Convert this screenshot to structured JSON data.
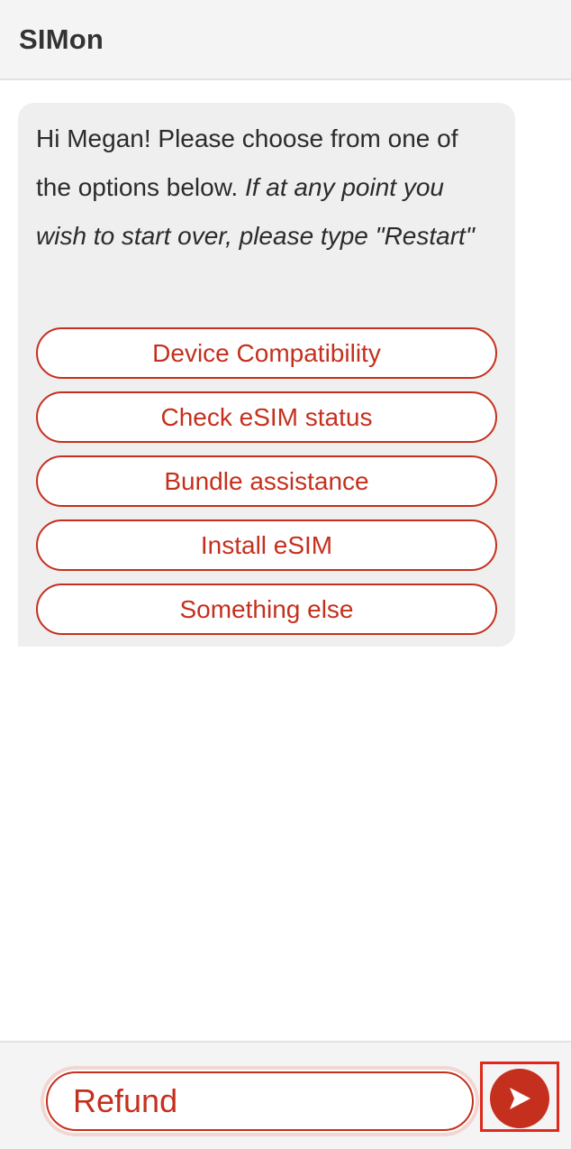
{
  "header": {
    "title": "SIMon"
  },
  "chat": {
    "greeting": "Hi Megan! Please choose from one of the options below.",
    "instruction": "If at any point you wish to start over, please type \"Restart\"",
    "options": [
      {
        "label": "Device Compatibility"
      },
      {
        "label": "Check eSIM status"
      },
      {
        "label": "Bundle assistance"
      },
      {
        "label": "Install eSIM"
      },
      {
        "label": "Something else"
      }
    ]
  },
  "composer": {
    "value": "Refund",
    "send_icon": "send-arrow-icon"
  },
  "colors": {
    "accent": "#c5301e",
    "bubble": "#efefef",
    "header": "#f4f4f4",
    "highlight": "#e0291c"
  }
}
